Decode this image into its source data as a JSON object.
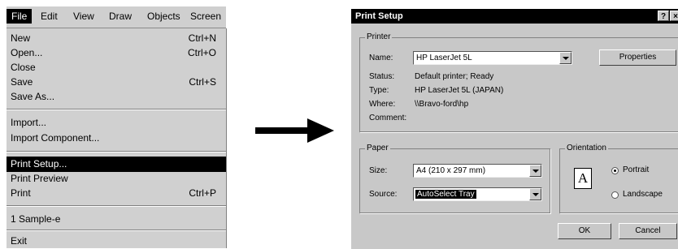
{
  "menubar": {
    "items": [
      "File",
      "Edit",
      "View",
      "Draw",
      "Objects",
      "Screen"
    ]
  },
  "file_menu": {
    "groups": [
      [
        {
          "label": "New",
          "shortcut": "Ctrl+N"
        },
        {
          "label": "Open...",
          "shortcut": "Ctrl+O"
        },
        {
          "label": "Close",
          "shortcut": ""
        },
        {
          "label": "Save",
          "shortcut": "Ctrl+S"
        },
        {
          "label": "Save As...",
          "shortcut": ""
        }
      ],
      [
        {
          "label": "Import...",
          "shortcut": ""
        },
        {
          "label": "Import Component...",
          "shortcut": ""
        }
      ],
      [
        {
          "label": "Print Setup...",
          "shortcut": "",
          "highlighted": true
        },
        {
          "label": "Print Preview",
          "shortcut": ""
        },
        {
          "label": "Print",
          "shortcut": "Ctrl+P"
        }
      ],
      [
        {
          "label": "1 Sample-e",
          "shortcut": ""
        }
      ],
      [
        {
          "label": "Exit",
          "shortcut": ""
        }
      ]
    ]
  },
  "dialog": {
    "title": "Print Setup",
    "title_buttons": [
      "?",
      "×"
    ],
    "printer": {
      "group_label": "Printer",
      "name_label": "Name:",
      "name_value": "HP LaserJet 5L",
      "properties_label": "Properties",
      "status_label": "Status:",
      "status_value": "Default printer; Ready",
      "type_label": "Type:",
      "type_value": "HP LaserJet 5L (JAPAN)",
      "where_label": "Where:",
      "where_value": "\\\\Bravo-ford\\hp",
      "comment_label": "Comment:"
    },
    "paper": {
      "group_label": "Paper",
      "size_label": "Size:",
      "size_value": "A4 (210 x 297 mm)",
      "source_label": "Source:",
      "source_value": "AutoSelect Tray"
    },
    "orientation": {
      "group_label": "Orientation",
      "icon_letter": "A",
      "portrait_label": "Portrait",
      "landscape_label": "Landscape",
      "selected": "Portrait"
    },
    "ok_label": "OK",
    "cancel_label": "Cancel"
  }
}
